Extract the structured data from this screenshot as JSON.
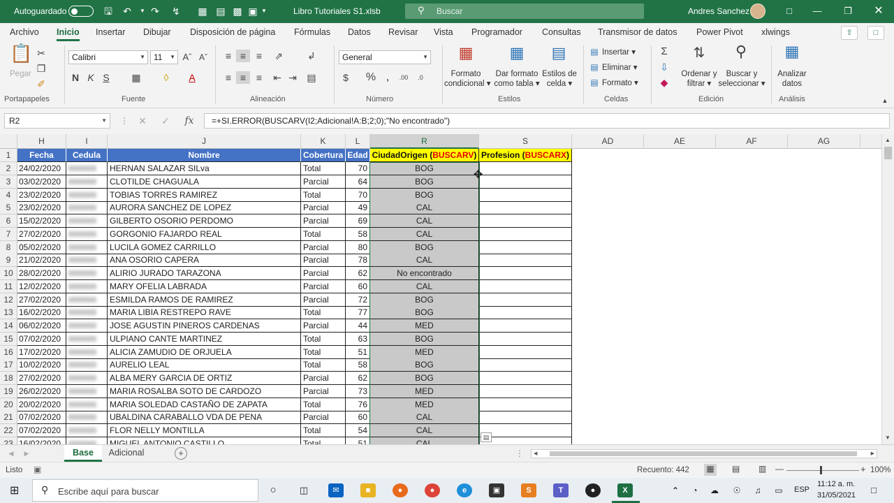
{
  "titlebar": {
    "autosave_label": "Autoguardado",
    "filename": "Libro Tutoriales S1.xlsb",
    "search_placeholder": "Buscar",
    "user": "Andres Sanchez"
  },
  "tabs": [
    "Archivo",
    "Inicio",
    "Insertar",
    "Dibujar",
    "Disposición de página",
    "Fórmulas",
    "Datos",
    "Revisar",
    "Vista",
    "Programador",
    "Consultas",
    "Transmisor de datos",
    "Power Pivot",
    "xlwings"
  ],
  "ribbon": {
    "clipboard": {
      "paste": "Pegar",
      "label": "Portapapeles"
    },
    "font": {
      "name": "Calibri",
      "size": "11",
      "label": "Fuente"
    },
    "alignment": {
      "label": "Alineación"
    },
    "number": {
      "format": "General",
      "label": "Número"
    },
    "styles": {
      "cond_line1": "Formato",
      "cond_line2": "condicional",
      "table_line1": "Dar formato",
      "table_line2": "como tabla",
      "cell_line1": "Estilos de",
      "cell_line2": "celda",
      "label": "Estilos"
    },
    "cells": {
      "insert": "Insertar",
      "delete": "Eliminar",
      "format": "Formato",
      "label": "Celdas"
    },
    "editing": {
      "sort_line1": "Ordenar y",
      "sort_line2": "filtrar",
      "find_line1": "Buscar y",
      "find_line2": "seleccionar",
      "label": "Edición"
    },
    "analysis": {
      "line1": "Analizar",
      "line2": "datos",
      "label": "Análisis"
    }
  },
  "formula_bar": {
    "name_box": "R2",
    "formula": "=+SI.ERROR(BUSCARV(I2;Adicional!A:B;2;0);\"No encontrado\")"
  },
  "grid": {
    "columns": [
      "H",
      "I",
      "J",
      "K",
      "L",
      "R",
      "S",
      "AD",
      "AE",
      "AF",
      "AG"
    ],
    "headers": {
      "fecha": "Fecha",
      "cedula": "Cedula",
      "nombre": "Nombre",
      "cobertura": "Cobertura",
      "edad": "Edad",
      "ciudad_a": "CiudadOrigen (",
      "ciudad_b": "BUSCARV",
      "ciudad_c": ")",
      "prof_a": "Profesion (",
      "prof_b": "BUSCARX",
      "prof_c": ")"
    },
    "rows": [
      {
        "n": "2",
        "fecha": "24/02/2020",
        "nombre": "HERNAN SALAZAR SILva",
        "cobertura": "Total",
        "edad": "70",
        "ciudad": "BOG"
      },
      {
        "n": "3",
        "fecha": "03/02/2020",
        "nombre": "CLOTILDE CHAGUALA",
        "cobertura": "Parcial",
        "edad": "64",
        "ciudad": "BOG"
      },
      {
        "n": "4",
        "fecha": "23/02/2020",
        "nombre": "TOBIAS TORRES RAMIREZ",
        "cobertura": "Total",
        "edad": "70",
        "ciudad": "BOG"
      },
      {
        "n": "5",
        "fecha": "23/02/2020",
        "nombre": "AURORA SANCHEZ DE LOPEZ",
        "cobertura": "Parcial",
        "edad": "49",
        "ciudad": "CAL"
      },
      {
        "n": "6",
        "fecha": "15/02/2020",
        "nombre": "GILBERTO OSORIO PERDOMO",
        "cobertura": "Parcial",
        "edad": "69",
        "ciudad": "CAL"
      },
      {
        "n": "7",
        "fecha": "27/02/2020",
        "nombre": "GORGONIO FAJARDO REAL",
        "cobertura": "Total",
        "edad": "58",
        "ciudad": "CAL"
      },
      {
        "n": "8",
        "fecha": "05/02/2020",
        "nombre": "LUCILA GOMEZ CARRILLO",
        "cobertura": "Parcial",
        "edad": "80",
        "ciudad": "BOG"
      },
      {
        "n": "9",
        "fecha": "21/02/2020",
        "nombre": "ANA OSORIO CAPERA",
        "cobertura": "Parcial",
        "edad": "78",
        "ciudad": "CAL"
      },
      {
        "n": "10",
        "fecha": "28/02/2020",
        "nombre": "ALIRIO JURADO TARAZONA",
        "cobertura": "Parcial",
        "edad": "62",
        "ciudad": "No encontrado"
      },
      {
        "n": "11",
        "fecha": "12/02/2020",
        "nombre": "MARY OFELIA LABRADA",
        "cobertura": "Parcial",
        "edad": "60",
        "ciudad": "CAL"
      },
      {
        "n": "12",
        "fecha": "27/02/2020",
        "nombre": "ESMILDA RAMOS DE RAMIREZ",
        "cobertura": "Parcial",
        "edad": "72",
        "ciudad": "BOG"
      },
      {
        "n": "13",
        "fecha": "16/02/2020",
        "nombre": "MARIA LIBIA RESTREPO RAVE",
        "cobertura": "Total",
        "edad": "77",
        "ciudad": "BOG"
      },
      {
        "n": "14",
        "fecha": "06/02/2020",
        "nombre": "JOSE AGUSTIN PINEROS CARDENAS",
        "cobertura": "Parcial",
        "edad": "44",
        "ciudad": "MED"
      },
      {
        "n": "15",
        "fecha": "07/02/2020",
        "nombre": "ULPIANO CANTE MARTINEZ",
        "cobertura": "Total",
        "edad": "63",
        "ciudad": "BOG"
      },
      {
        "n": "16",
        "fecha": "17/02/2020",
        "nombre": "ALICIA ZAMUDIO DE ORJUELA",
        "cobertura": "Total",
        "edad": "51",
        "ciudad": "MED"
      },
      {
        "n": "17",
        "fecha": "10/02/2020",
        "nombre": "AURELIO LEAL",
        "cobertura": "Total",
        "edad": "58",
        "ciudad": "BOG"
      },
      {
        "n": "18",
        "fecha": "27/02/2020",
        "nombre": "ALBA MERY GARCIA DE ORTIZ",
        "cobertura": "Parcial",
        "edad": "62",
        "ciudad": "BOG"
      },
      {
        "n": "19",
        "fecha": "26/02/2020",
        "nombre": "MARIA ROSALBA SOTO DE CARDOZO",
        "cobertura": "Parcial",
        "edad": "73",
        "ciudad": "MED"
      },
      {
        "n": "20",
        "fecha": "20/02/2020",
        "nombre": "MARIA SOLEDAD CASTAÑO DE ZAPATA",
        "cobertura": "Total",
        "edad": "76",
        "ciudad": "MED"
      },
      {
        "n": "21",
        "fecha": "07/02/2020",
        "nombre": "UBALDINA CARABALLO VDA DE PENA",
        "cobertura": "Parcial",
        "edad": "60",
        "ciudad": "CAL"
      },
      {
        "n": "22",
        "fecha": "07/02/2020",
        "nombre": "FLOR NELLY MONTILLA",
        "cobertura": "Total",
        "edad": "54",
        "ciudad": "CAL"
      },
      {
        "n": "23",
        "fecha": "16/02/2020",
        "nombre": "MIGUEL ANTONIO CASTILLO",
        "cobertura": "Total",
        "edad": "51",
        "ciudad": "CAL"
      }
    ]
  },
  "sheets": {
    "active": "Base",
    "other": "Adicional"
  },
  "status": {
    "ready": "Listo",
    "count": "Recuento: 442",
    "zoom": "100%"
  },
  "taskbar": {
    "search_placeholder": "Escribe aquí para buscar",
    "lang": "ESP",
    "time": "11:12 a. m.",
    "date": "31/05/2021"
  },
  "colors": {
    "excel_green": "#217346",
    "header_blue": "#4472c4",
    "yellow": "#ffff00",
    "red": "#e00000"
  }
}
